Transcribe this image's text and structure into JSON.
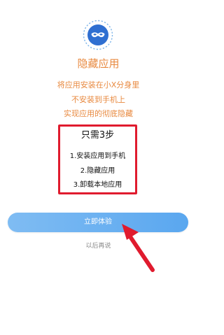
{
  "app": {
    "title": "隐藏应用",
    "description_lines": [
      "将应用安装在小X分身里",
      "不安装到手机上",
      "实现应用的彻底隐藏"
    ]
  },
  "steps_box": {
    "heading": "只需3步",
    "steps": [
      "1.安装应用到手机",
      "2.隐藏应用",
      "3.卸载本地应用"
    ]
  },
  "actions": {
    "primary_label": "立即体验",
    "secondary_label": "以后再说"
  },
  "icons": {
    "logo": "mask-logo-icon",
    "annotation": "red-arrow-icon"
  },
  "colors": {
    "title_orange": "#e8893f",
    "button_blue": "#5aa7ef",
    "highlight_red": "#e01b2e",
    "secondary_gray": "#8a8a8a"
  }
}
